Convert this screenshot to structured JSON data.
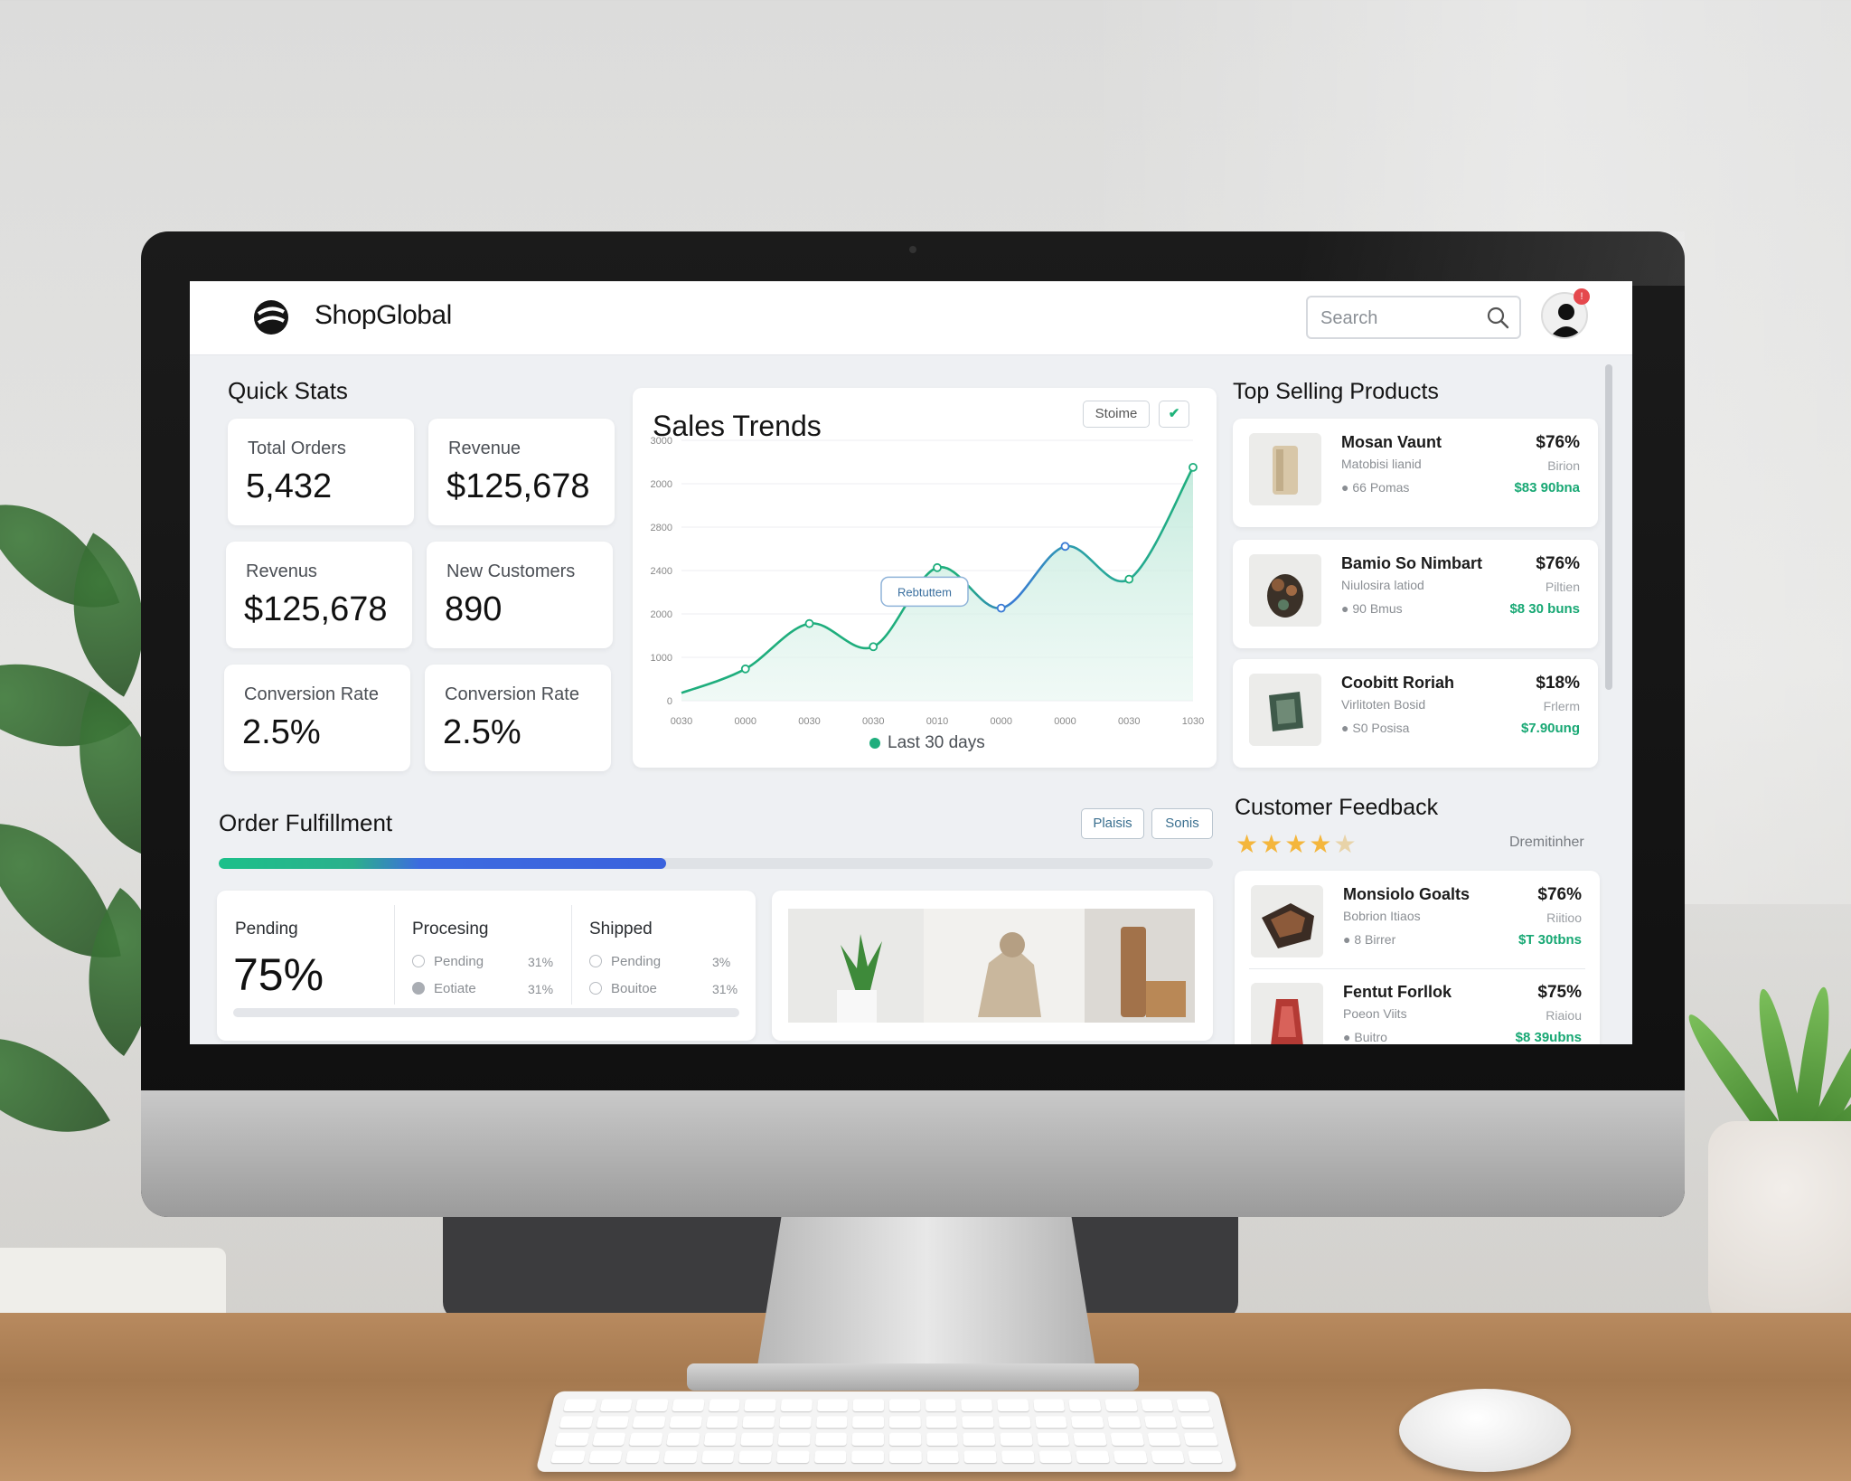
{
  "app": {
    "brand": "ShopGlobal",
    "search_placeholder": "Search",
    "notification_count": "!"
  },
  "quick_stats": {
    "title": "Quick Stats",
    "cards": [
      {
        "label": "Total Orders",
        "value": "5,432"
      },
      {
        "label": "Revenue",
        "value": "$125,678"
      },
      {
        "label": "Revenus",
        "value": "$125,678"
      },
      {
        "label": "New Customers",
        "value": "890"
      },
      {
        "label": "Conversion Rate",
        "value": "2.5%"
      },
      {
        "label": "Conversion Rate",
        "value": "2.5%"
      }
    ]
  },
  "sales_trends": {
    "title": "Sales Trends",
    "chip_label": "Stoime",
    "tooltip": "Rebtuttem",
    "legend": "Last 30 days"
  },
  "chart_data": {
    "type": "area",
    "title": "Sales Trends",
    "y_tick_labels": [
      "3000",
      "2000",
      "2800",
      "2400",
      "2000",
      "1000",
      "0"
    ],
    "x_tick_labels": [
      "0030",
      "0000",
      "0030",
      "0030",
      "0010",
      "0000",
      "0000",
      "0030",
      "1030"
    ],
    "series": [
      {
        "name": "Last 30 days",
        "color": "#1fae7d",
        "x": [
          0,
          1,
          2,
          3,
          4,
          5,
          6,
          7,
          8
        ],
        "y": [
          80,
          330,
          800,
          560,
          1380,
          960,
          1600,
          1260,
          2420
        ]
      }
    ],
    "ylim": [
      0,
      2700
    ],
    "grid": true
  },
  "top_products": {
    "title": "Top Selling Products",
    "items": [
      {
        "name": "Mosan Vaunt",
        "sub": "Matobisi lianid",
        "stock": "66 Pomas",
        "pct": "$76%",
        "sub2": "Birion",
        "price": "$83 90bna"
      },
      {
        "name": "Bamio So Nimbart",
        "sub": "Niulosira latiod",
        "stock": "90 Bmus",
        "pct": "$76%",
        "sub2": "Piltien",
        "price": "$8 30 buns"
      },
      {
        "name": "Coobitt Roriah",
        "sub": "Virlitoten Bosid",
        "stock": "S0 Posisa",
        "pct": "$18%",
        "sub2": "Frlerm",
        "price": "$7.90ung"
      }
    ]
  },
  "order_fulfillment": {
    "title": "Order Fulfillment",
    "buttons": [
      "Plaisis",
      "Sonis"
    ],
    "progress": 0.45,
    "pending_label": "Pending",
    "pending_value": "75%",
    "processing": {
      "label": "Procesing",
      "rows": [
        {
          "label": "Pending",
          "pct": "31%"
        },
        {
          "label": "Eotiate",
          "pct": "31%"
        }
      ]
    },
    "shipped": {
      "label": "Shipped",
      "rows": [
        {
          "label": "Pending",
          "pct": "3%"
        },
        {
          "label": "Bouitoe",
          "pct": "31%"
        }
      ]
    }
  },
  "customer_feedback": {
    "title": "Customer Feedback",
    "rating": 4.5,
    "meta": "Dremitinher",
    "items": [
      {
        "name": "Monsiolo Goalts",
        "sub": "Bobrion Itiaos",
        "stock": "8 Birrer",
        "pct": "$76%",
        "sub2": "Riitioo",
        "price": "$T 30tbns"
      },
      {
        "name": "Fentut Forllok",
        "sub": "Poeon Viits",
        "stock": "Buitro",
        "pct": "$75%",
        "sub2": "Riaiou",
        "price": "$8 39ubns"
      }
    ]
  }
}
